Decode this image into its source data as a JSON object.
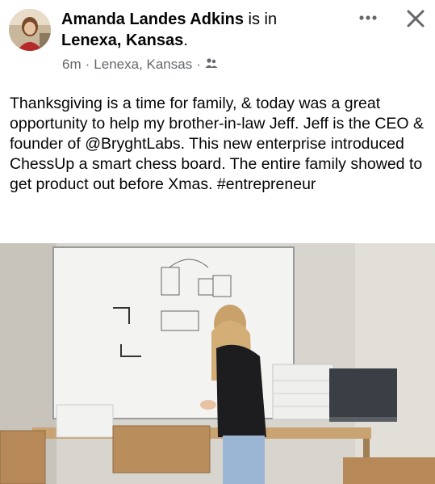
{
  "post": {
    "author_name": "Amanda Landes Adkins",
    "is_in": "is in",
    "location_line": "Lenexa, Kansas",
    "location_period": ".",
    "time": "6m",
    "meta_location": "Lenexa, Kansas",
    "separator": "·",
    "audience_icon": "friends-icon",
    "text": "Thanksgiving is a time for family, & today was a great opportunity to help my brother-in-law Jeff. Jeff is the CEO & founder of @BryghtLabs. This new enterprise introduced ChessUp a smart chess board. The entire family showed to get product out before Xmas. #entrepreneur"
  },
  "icons": {
    "more": "more-options-icon",
    "close": "close-icon"
  },
  "colors": {
    "text": "#050505",
    "secondary": "#65676b",
    "background": "#ffffff"
  }
}
